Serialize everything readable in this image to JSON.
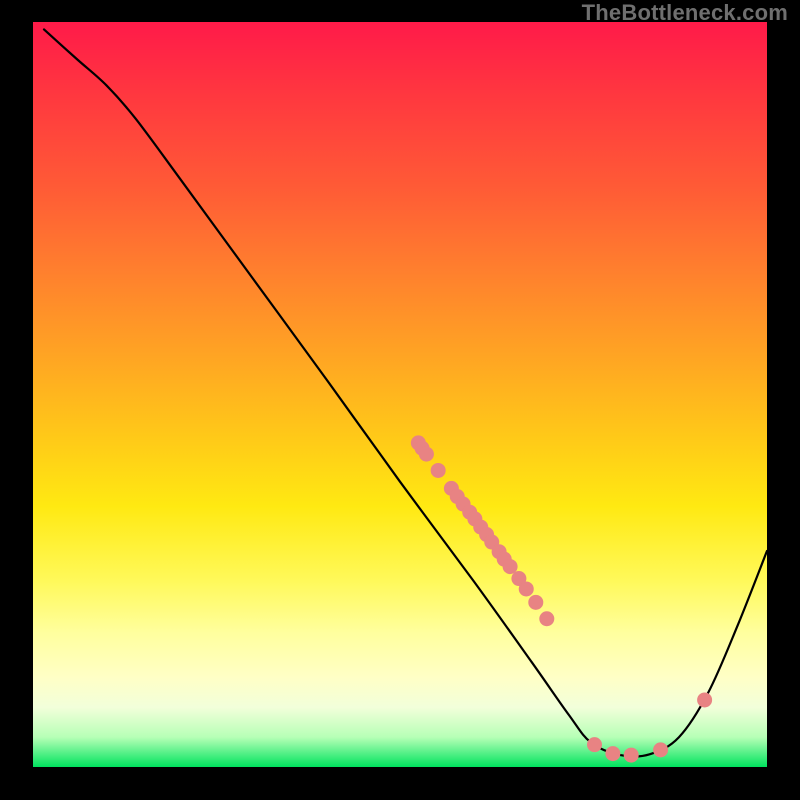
{
  "watermark": "TheBottleneck.com",
  "chart_data": {
    "type": "line",
    "title": "",
    "xlabel": "",
    "ylabel": "",
    "xlim": [
      0,
      100
    ],
    "ylim": [
      0,
      100
    ],
    "curve": [
      {
        "x": 1.5,
        "y": 99
      },
      {
        "x": 6,
        "y": 95
      },
      {
        "x": 10,
        "y": 91.5
      },
      {
        "x": 14,
        "y": 87
      },
      {
        "x": 20,
        "y": 79
      },
      {
        "x": 30,
        "y": 65.5
      },
      {
        "x": 40,
        "y": 52
      },
      {
        "x": 50,
        "y": 38.3
      },
      {
        "x": 60,
        "y": 25
      },
      {
        "x": 68,
        "y": 14
      },
      {
        "x": 73,
        "y": 7
      },
      {
        "x": 76,
        "y": 3.3
      },
      {
        "x": 80,
        "y": 1.6
      },
      {
        "x": 84,
        "y": 1.7
      },
      {
        "x": 88,
        "y": 4
      },
      {
        "x": 92,
        "y": 10
      },
      {
        "x": 96,
        "y": 19
      },
      {
        "x": 100,
        "y": 29
      }
    ],
    "points": [
      {
        "x": 52.5,
        "y": 43.5
      },
      {
        "x": 53.0,
        "y": 42.8
      },
      {
        "x": 53.6,
        "y": 42.0
      },
      {
        "x": 55.2,
        "y": 39.8
      },
      {
        "x": 57.0,
        "y": 37.4
      },
      {
        "x": 57.8,
        "y": 36.3
      },
      {
        "x": 58.6,
        "y": 35.3
      },
      {
        "x": 59.5,
        "y": 34.2
      },
      {
        "x": 60.2,
        "y": 33.3
      },
      {
        "x": 61.0,
        "y": 32.2
      },
      {
        "x": 61.8,
        "y": 31.2
      },
      {
        "x": 62.5,
        "y": 30.2
      },
      {
        "x": 63.5,
        "y": 28.9
      },
      {
        "x": 64.2,
        "y": 27.9
      },
      {
        "x": 65.0,
        "y": 26.9
      },
      {
        "x": 66.2,
        "y": 25.3
      },
      {
        "x": 67.2,
        "y": 23.9
      },
      {
        "x": 68.5,
        "y": 22.1
      },
      {
        "x": 70.0,
        "y": 19.9
      },
      {
        "x": 76.5,
        "y": 3.0
      },
      {
        "x": 79.0,
        "y": 1.8
      },
      {
        "x": 81.5,
        "y": 1.6
      },
      {
        "x": 85.5,
        "y": 2.3
      },
      {
        "x": 91.5,
        "y": 9.0
      }
    ],
    "colors": {
      "curve": "#000000",
      "points": "#e88383",
      "gradient_top": "#ff1a49",
      "gradient_bottom": "#00e35e"
    }
  }
}
